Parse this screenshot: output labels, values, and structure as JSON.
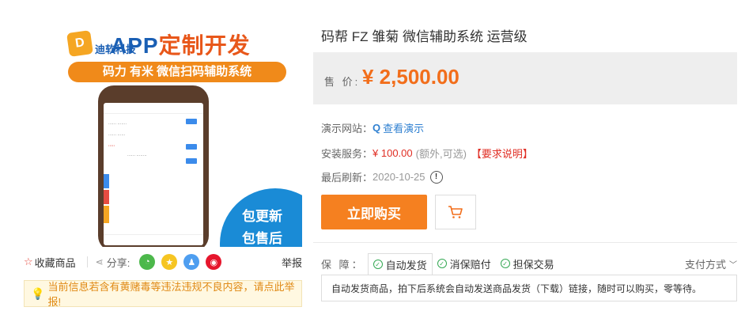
{
  "image": {
    "brand_logo": "D",
    "brand_name": "迪软科技",
    "title_part1": "APP",
    "title_part2": "定制开发",
    "banner": "码力 有米 微信扫码辅助系统",
    "bubble_line1": "包更新",
    "bubble_line2": "包售后"
  },
  "actions": {
    "favorite": "收藏商品",
    "share": "分享:",
    "report": "举报"
  },
  "notice": "当前信息若含有黄赌毒等违法违规不良内容，请点此举报!",
  "product": {
    "title": "码帮 FZ 雏菊 微信辅助系统 运营级",
    "price_label": "售 价:",
    "price": "¥ 2,500.00",
    "demo_label": "演示网站：",
    "demo_link": "查看演示",
    "install_label": "安装服务：",
    "install_price": "¥ 100.00",
    "install_note": "(额外,可选)",
    "install_req": "【要求说明】",
    "refresh_label": "最后刷新：",
    "refresh_date": "2020-10-25",
    "buy_button": "立即购买"
  },
  "guarantee": {
    "label": "保 障：",
    "items": [
      "自动发货",
      "消保赔付",
      "担保交易"
    ],
    "pay_methods": "支付方式",
    "description": "自动发货商品，拍下后系统会自动发送商品发货（下载）链接，随时可以购买，零等待。"
  },
  "colors": {
    "price": "#f26e1b",
    "buy_button": "#f58020",
    "link": "#2f80d1",
    "notice_text": "#e08a16"
  }
}
